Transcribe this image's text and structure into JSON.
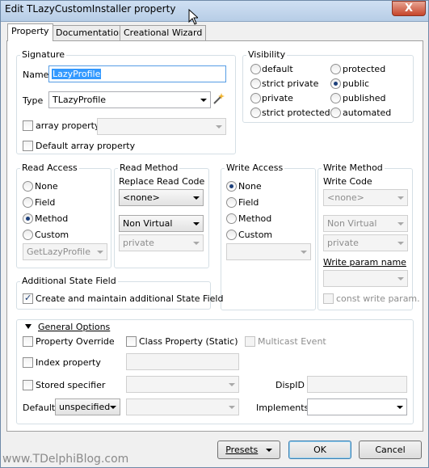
{
  "window": {
    "title": "Edit TLazyCustomInstaller property",
    "close_label": "X"
  },
  "tabs": [
    {
      "label": "Property"
    },
    {
      "label": "Documentation"
    },
    {
      "label": "Creational Wizard"
    }
  ],
  "signature": {
    "group_label": "Signature",
    "name_label": "Name",
    "name_value": "LazyProfile",
    "type_label": "Type",
    "type_value": "TLazyProfile",
    "array_property_label": "array property",
    "default_array_label": "Default array property"
  },
  "visibility": {
    "group_label": "Visibility",
    "options": [
      "default",
      "protected",
      "strict private",
      "public",
      "private",
      "published",
      "strict protected",
      "automated"
    ],
    "selected": "public"
  },
  "read_access": {
    "group_label": "Read Access",
    "options": [
      "None",
      "Field",
      "Method",
      "Custom"
    ],
    "selected": "Method",
    "custom_value": "GetLazyProfile"
  },
  "read_method": {
    "group_label": "Read Method",
    "replace_label": "Replace Read Code",
    "code_value": "<none>",
    "virtual_value": "Non Virtual",
    "visibility_value": "private"
  },
  "write_access": {
    "group_label": "Write Access",
    "options": [
      "None",
      "Field",
      "Method",
      "Custom"
    ],
    "selected": "None"
  },
  "write_method": {
    "group_label": "Write Method",
    "code_label": "Write Code",
    "code_value": "<none>",
    "virtual_value": "Non Virtual",
    "visibility_value": "private",
    "param_name_label": "Write param name",
    "const_label": "const write param."
  },
  "state_field": {
    "group_label": "Additional State Field",
    "create_label": "Create and maintain additional State Field"
  },
  "general": {
    "header_label": "General Options",
    "property_override_label": "Property Override",
    "class_property_label": "Class Property (Static)",
    "multicast_label": "Multicast Event",
    "index_property_label": "Index property",
    "stored_specifier_label": "Stored specifier",
    "dispid_label": "DispID",
    "default_label": "Default",
    "default_value": "unspecified",
    "implements_label": "Implements"
  },
  "buttons": {
    "presets": "Presets",
    "ok": "OK",
    "cancel": "Cancel"
  },
  "watermark": "www.TDelphiBlog.com"
}
